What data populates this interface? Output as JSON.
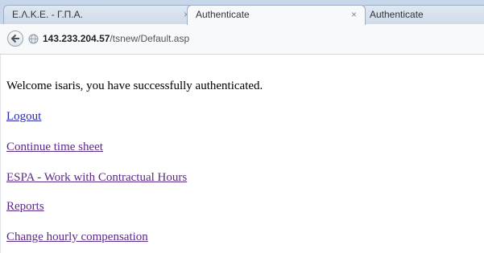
{
  "tabs": [
    {
      "title": "Ε.Λ.Κ.Ε. - Γ.Π.Α.",
      "close": "×"
    },
    {
      "title": "Authenticate",
      "close": "×"
    },
    {
      "title": "Authenticate"
    }
  ],
  "address_bar": {
    "host": "143.233.204.57",
    "path": "/tsnew/Default.asp"
  },
  "page": {
    "welcome": "Welcome isaris, you have successfully authenticated.",
    "links": [
      "Logout",
      "Continue time sheet",
      "ESPA - Work with Contractual Hours",
      "Reports",
      "Change hourly compensation"
    ]
  },
  "colors": {
    "link": "#2a2bb0",
    "visited_link": "#5b2a86"
  }
}
